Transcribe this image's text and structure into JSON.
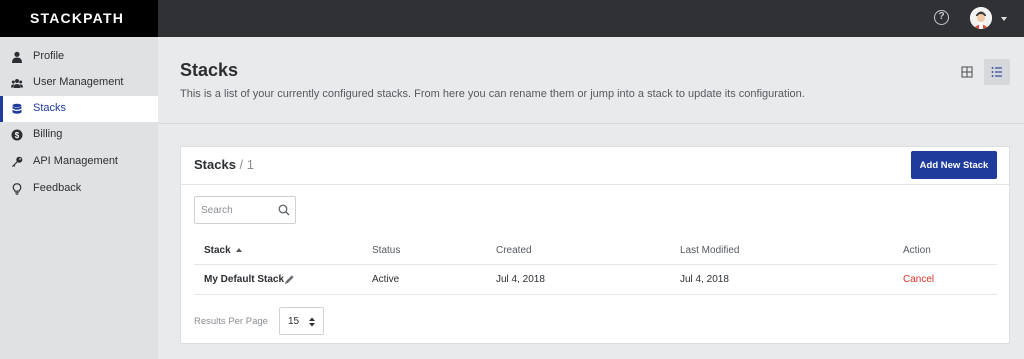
{
  "brand": {
    "logo_text": "STACKPATH"
  },
  "topbar": {
    "help_icon": "question-circle-icon",
    "avatar_icon": "user-avatar"
  },
  "sidebar": {
    "items": [
      {
        "label": "Profile",
        "icon": "person-icon"
      },
      {
        "label": "User Management",
        "icon": "users-icon"
      },
      {
        "label": "Stacks",
        "icon": "database-icon",
        "active": true
      },
      {
        "label": "Billing",
        "icon": "dollar-circle-icon"
      },
      {
        "label": "API Management",
        "icon": "key-icon"
      },
      {
        "label": "Feedback",
        "icon": "lightbulb-icon"
      }
    ]
  },
  "page": {
    "title": "Stacks",
    "description": "This is a list of your currently configured stacks. From here you can rename them or jump into a stack to update its configuration.",
    "view_toggle": {
      "grid_icon": "grid-view-icon",
      "list_icon": "list-view-icon",
      "selected": "list"
    }
  },
  "card": {
    "title": "Stacks",
    "count": "/ 1",
    "add_button": "Add New Stack",
    "search_placeholder": "Search",
    "columns": {
      "stack": "Stack",
      "status": "Status",
      "created": "Created",
      "modified": "Last Modified",
      "action": "Action"
    },
    "rows": [
      {
        "name": "My Default Stack",
        "status": "Active",
        "created": "Jul 4, 2018",
        "modified": "Jul 4, 2018",
        "action": "Cancel"
      }
    ],
    "results_per_page_label": "Results Per Page",
    "results_per_page_value": "15"
  },
  "colors": {
    "accent": "#1f3b9c",
    "cancel": "#d9342b",
    "topbar": "#2f3134"
  }
}
